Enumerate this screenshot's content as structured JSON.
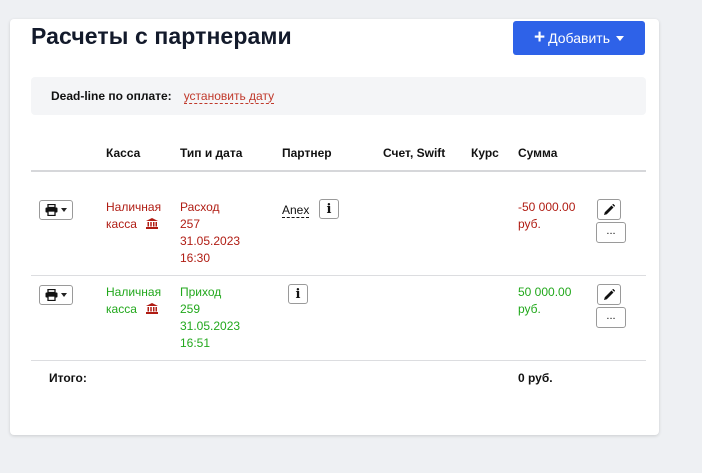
{
  "header": {
    "title": "Расчеты с партнерами",
    "add_label": "Добавить"
  },
  "deadline": {
    "label": "Dead-line по оплате:",
    "link": "установить дату"
  },
  "table": {
    "columns": [
      "Касса",
      "Тип и дата",
      "Партнер",
      "Счет, Swift",
      "Курс",
      "Сумма"
    ],
    "rows": [
      {
        "kassa_line1": "Наличная",
        "kassa_line2": "касса",
        "type": "Расход",
        "number": "257",
        "date": "31.05.2023",
        "time": "16:30",
        "partner": "Anex",
        "account": "",
        "rate": "",
        "amount": "-50 000.00",
        "currency": "руб.",
        "more_label": "...",
        "color": "#b01c13"
      },
      {
        "kassa_line1": "Наличная",
        "kassa_line2": "касса",
        "type": "Приход",
        "number": "259",
        "date": "31.05.2023",
        "time": "16:51",
        "partner": "",
        "account": "",
        "rate": "",
        "amount": "50 000.00",
        "currency": "руб.",
        "more_label": "...",
        "color": "#22a81c"
      }
    ],
    "total_label": "Итого:",
    "total_value": "0 руб."
  },
  "icons": {
    "add": "plus-icon",
    "print": "printer-icon",
    "bank": "bank-icon",
    "info": "info-icon",
    "edit": "pencil-icon"
  },
  "colors": {
    "accent": "#2e62e8",
    "expense": "#b01c13",
    "income": "#22a81c",
    "link": "#c0392b"
  }
}
